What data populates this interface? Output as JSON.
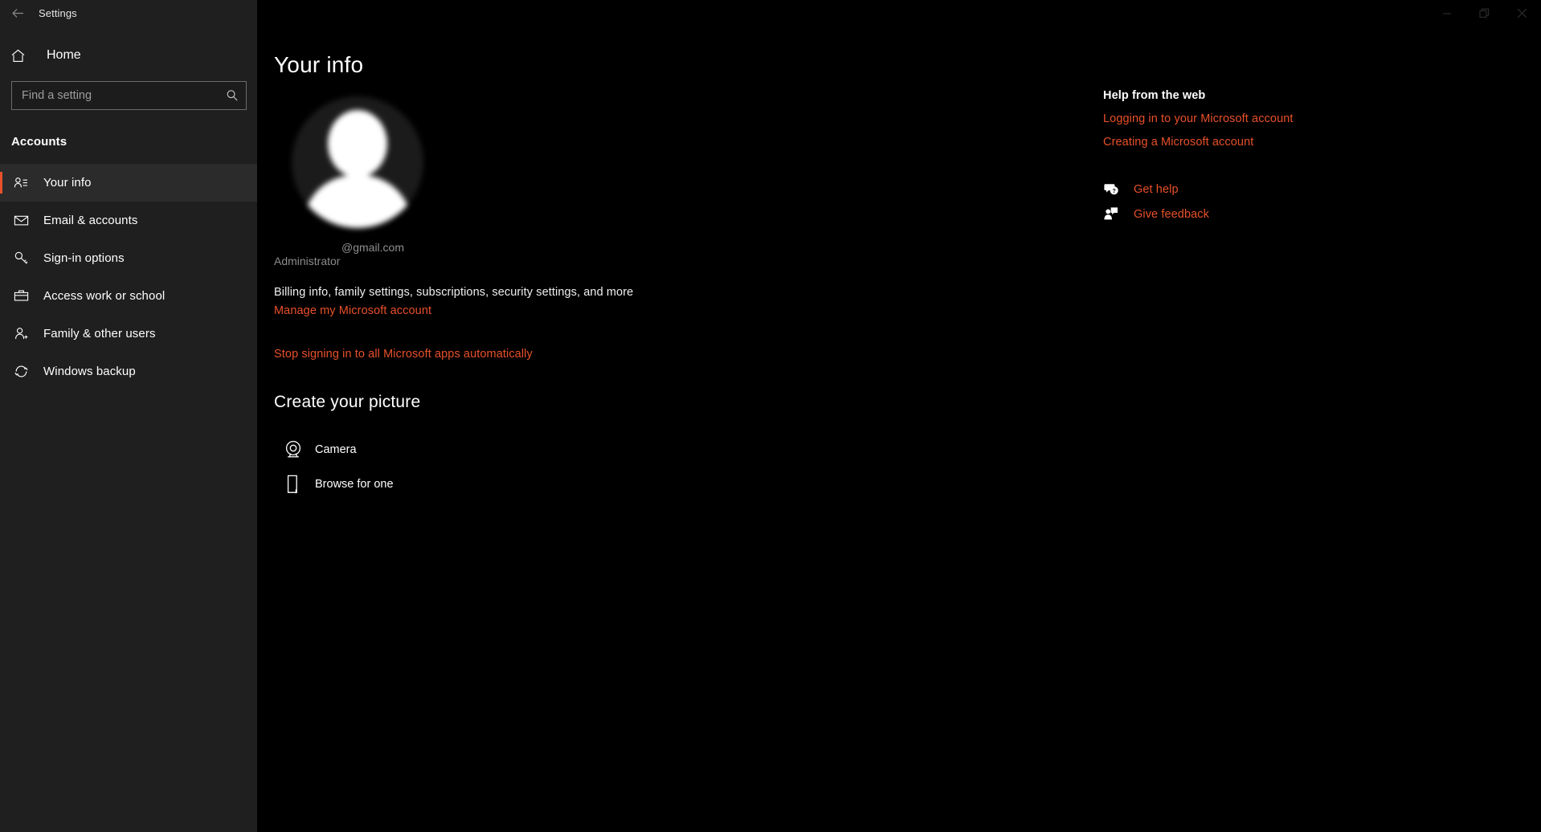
{
  "window": {
    "title": "Settings",
    "back_icon": "back-arrow-icon",
    "controls": {
      "minimize": "minimize-icon",
      "restore": "restore-icon",
      "close": "close-icon"
    }
  },
  "sidebar": {
    "home_label": "Home",
    "home_icon": "home-icon",
    "search": {
      "placeholder": "Find a setting",
      "value": "",
      "icon": "search-icon"
    },
    "category": "Accounts",
    "items": [
      {
        "label": "Your info",
        "icon": "user-card-icon",
        "selected": true
      },
      {
        "label": "Email & accounts",
        "icon": "mail-icon",
        "selected": false
      },
      {
        "label": "Sign-in options",
        "icon": "key-icon",
        "selected": false
      },
      {
        "label": "Access work or school",
        "icon": "briefcase-icon",
        "selected": false
      },
      {
        "label": "Family & other users",
        "icon": "person-add-icon",
        "selected": false
      },
      {
        "label": "Windows backup",
        "icon": "sync-refresh-icon",
        "selected": false
      }
    ]
  },
  "main": {
    "page_title": "Your info",
    "avatar_icon": "default-account-picture",
    "email": "@gmail.com",
    "role": "Administrator",
    "billing_text": "Billing info, family settings, subscriptions, security settings, and more",
    "manage_account_link": "Manage my Microsoft account",
    "stop_signing_link": "Stop signing in to all Microsoft apps automatically",
    "create_picture_title": "Create your picture",
    "picture_options": [
      {
        "label": "Camera",
        "icon": "camera-icon"
      },
      {
        "label": "Browse for one",
        "icon": "folder-browse-icon"
      }
    ]
  },
  "help": {
    "title": "Help from the web",
    "links": [
      "Logging in to your Microsoft account",
      "Creating a Microsoft account"
    ],
    "actions": [
      {
        "label": "Get help",
        "icon": "question-chat-icon"
      },
      {
        "label": "Give feedback",
        "icon": "feedback-person-icon"
      }
    ]
  },
  "colors": {
    "accent": "#e8502a",
    "sidebar_bg": "#1f1f1f",
    "content_bg": "#000000",
    "text": "#ffffff",
    "muted_text": "#8f8f8f"
  }
}
